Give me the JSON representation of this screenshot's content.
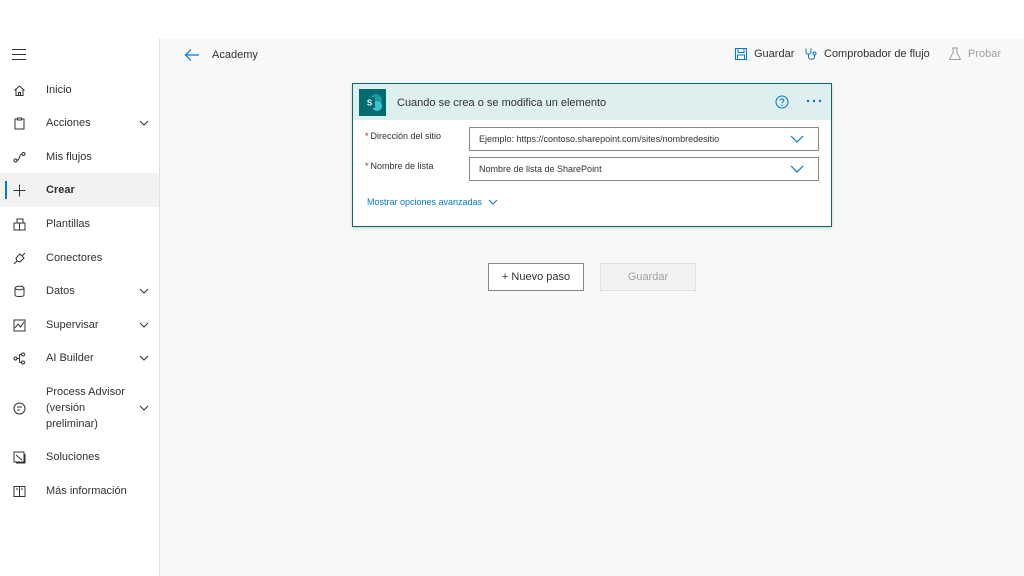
{
  "sidebar": {
    "items": [
      {
        "label": "Inicio",
        "icon": "home-icon"
      },
      {
        "label": "Acciones",
        "icon": "clipboard-icon",
        "expandable": true
      },
      {
        "label": "Mis flujos",
        "icon": "flow-icon"
      },
      {
        "label": "Crear",
        "icon": "plus-icon",
        "active": true
      },
      {
        "label": "Plantillas",
        "icon": "templates-icon"
      },
      {
        "label": "Conectores",
        "icon": "connector-icon"
      },
      {
        "label": "Datos",
        "icon": "database-icon",
        "expandable": true
      },
      {
        "label": "Supervisar",
        "icon": "monitor-icon",
        "expandable": true
      },
      {
        "label": "AI Builder",
        "icon": "ai-builder-icon",
        "expandable": true
      },
      {
        "label": "Process Advisor (versión preliminar)",
        "icon": "process-advisor-icon",
        "expandable": true
      },
      {
        "label": "Soluciones",
        "icon": "solutions-icon"
      },
      {
        "label": "Más información",
        "icon": "book-icon"
      }
    ]
  },
  "topbar": {
    "flow_name": "Academy",
    "save_label": "Guardar",
    "checker_label": "Comprobador de flujo",
    "test_label": "Probar"
  },
  "trigger_card": {
    "title": "Cuando se crea o se modifica un elemento",
    "fields": [
      {
        "label": "Dirección del sitio",
        "required": true,
        "placeholder": "Ejemplo: https://contoso.sharepoint.com/sites/nombredesitio"
      },
      {
        "label": "Nombre de lista",
        "required": true,
        "placeholder": "Nombre de lista de SharePoint"
      }
    ],
    "advanced_label": "Mostrar opciones avanzadas"
  },
  "actions": {
    "new_step_label": "+ Nuevo paso",
    "save_label": "Guardar"
  },
  "colors": {
    "accent": "#0078d4",
    "card_header": "#deefef",
    "card_border": "#0b6a66",
    "sharepoint": "#036c70"
  }
}
